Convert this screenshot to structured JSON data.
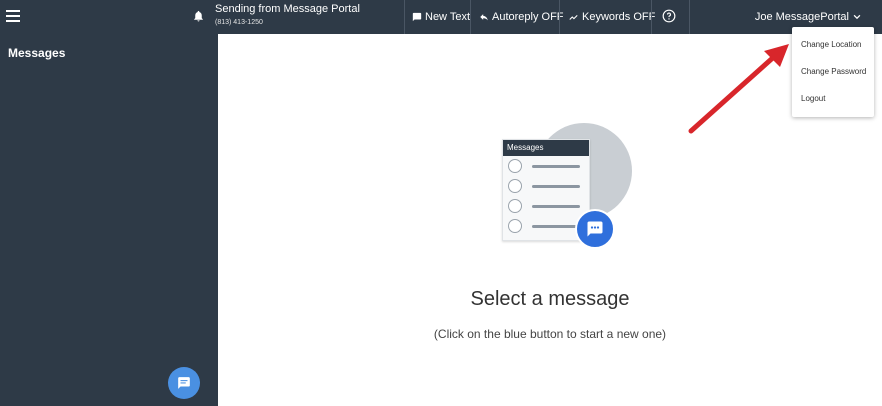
{
  "topbar": {
    "sending_from": "Sending from Message Portal",
    "phone": "(813) 413-1250",
    "new_text": "New Text",
    "autoreply": "Autoreply OFF",
    "keywords": "Keywords OFF",
    "user_name": "Joe MessagePortal"
  },
  "sidebar": {
    "title": "Messages"
  },
  "main": {
    "illustration_header": "Messages",
    "select_title": "Select a message",
    "select_subtitle": "(Click on the blue button to start a new one)"
  },
  "dropdown": {
    "items": [
      "Change Location",
      "Change Password",
      "Logout"
    ]
  },
  "colors": {
    "navbar": "#2e3a47",
    "accent_blue": "#4a90e2",
    "arrow_red": "#d8262b"
  }
}
